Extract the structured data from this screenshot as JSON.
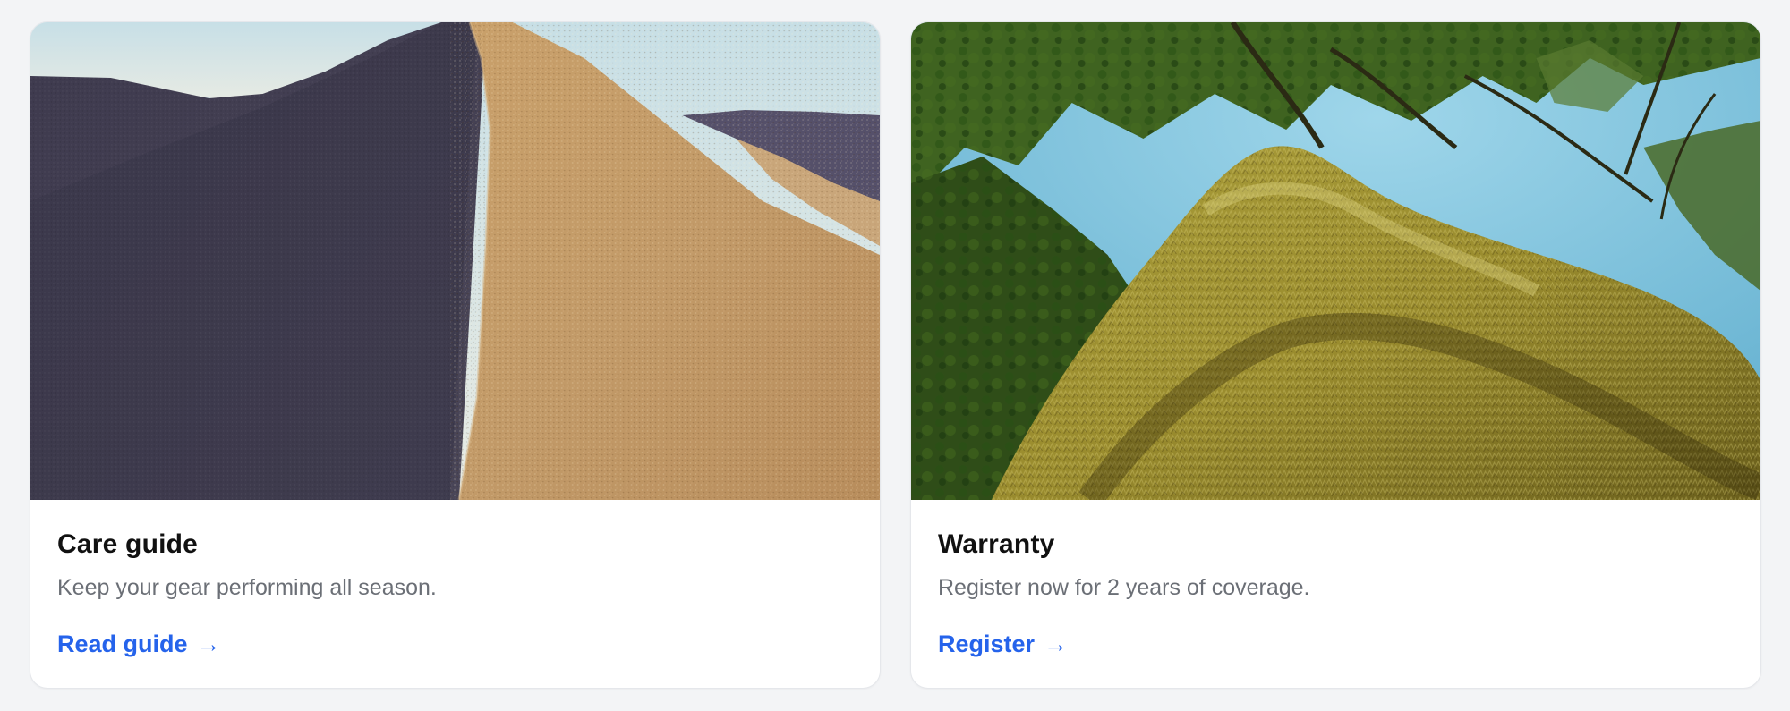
{
  "cards": [
    {
      "image": "sand-dune-photo",
      "title": "Care guide",
      "description": "Keep your gear performing all season.",
      "link_label": "Read guide",
      "link_icon": "arrow-right-icon"
    },
    {
      "image": "mossy-tree-photo",
      "title": "Warranty",
      "description": "Register now for 2 years of coverage.",
      "link_label": "Register",
      "link_icon": "arrow-right-icon"
    }
  ],
  "colors": {
    "page_background": "#f3f4f6",
    "card_background": "#ffffff",
    "title": "#111111",
    "description": "#6b6f76",
    "link": "#2563eb"
  }
}
